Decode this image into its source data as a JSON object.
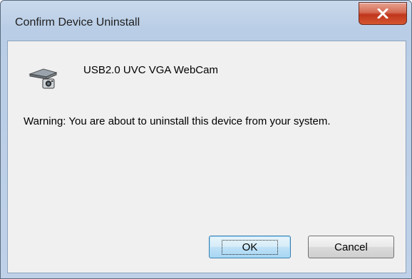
{
  "window": {
    "title": "Confirm Device Uninstall"
  },
  "device": {
    "name": "USB2.0 UVC VGA WebCam",
    "icon": "webcam-icon"
  },
  "message": {
    "warning": "Warning: You are about to uninstall this device from your system."
  },
  "buttons": {
    "ok_label": "OK",
    "cancel_label": "Cancel",
    "close_icon": "close-icon"
  },
  "colors": {
    "close_button": "#c0361c",
    "frame": "#b9cde6",
    "client": "#f0f0f0",
    "default_button_border": "#3c7fb1"
  }
}
